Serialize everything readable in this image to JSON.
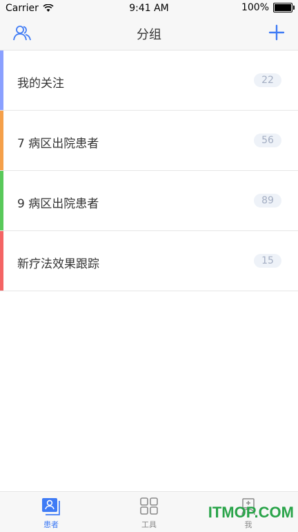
{
  "status_bar": {
    "carrier": "Carrier",
    "time": "9:41 AM",
    "battery": "100%"
  },
  "nav": {
    "title": "分组"
  },
  "groups": [
    {
      "name": "我的关注",
      "count": "22",
      "color": "#8aa0ff"
    },
    {
      "name": "7 病区出院患者",
      "count": "56",
      "color": "#f5a04a"
    },
    {
      "name": "9 病区出院患者",
      "count": "89",
      "color": "#59c95a"
    },
    {
      "name": "新疗法效果跟踪",
      "count": "15",
      "color": "#f46464"
    }
  ],
  "tabs": [
    {
      "label": "患者"
    },
    {
      "label": "工具"
    },
    {
      "label": "我"
    }
  ],
  "watermark": "ITMOP.COM"
}
